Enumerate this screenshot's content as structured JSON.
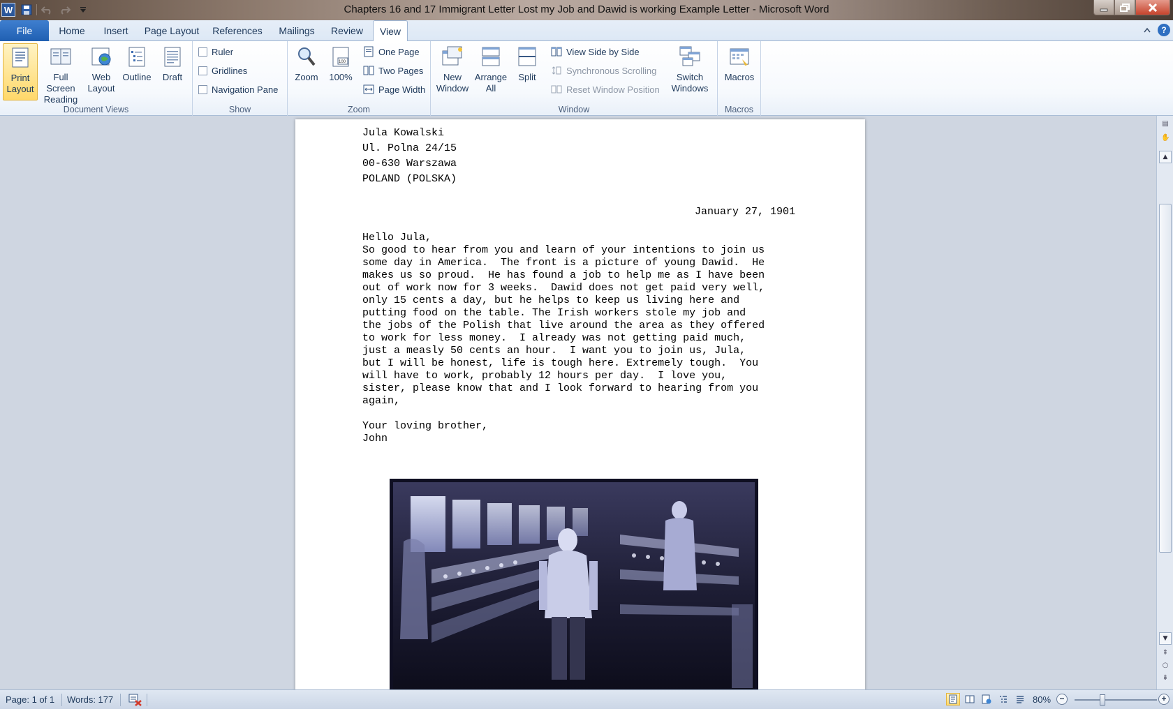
{
  "window": {
    "title": "Chapters 16 and 17 Immigrant Letter  Lost my Job and Dawid is working  Example Letter  -  Microsoft Word",
    "app_logo": "W"
  },
  "tabs": {
    "file": "File",
    "items": [
      "Home",
      "Insert",
      "Page Layout",
      "References",
      "Mailings",
      "Review",
      "View"
    ],
    "active": "View"
  },
  "ribbon": {
    "document_views": {
      "label": "Document Views",
      "print_layout": [
        "Print",
        "Layout"
      ],
      "full_screen": [
        "Full Screen",
        "Reading"
      ],
      "web_layout": [
        "Web",
        "Layout"
      ],
      "outline": "Outline",
      "draft": "Draft"
    },
    "show": {
      "label": "Show",
      "ruler": "Ruler",
      "gridlines": "Gridlines",
      "navigation_pane": "Navigation Pane"
    },
    "zoom": {
      "label": "Zoom",
      "zoom": "Zoom",
      "hundred": "100%",
      "one_page": "One Page",
      "two_pages": "Two Pages",
      "page_width": "Page Width"
    },
    "window": {
      "label": "Window",
      "new_window": [
        "New",
        "Window"
      ],
      "arrange_all": [
        "Arrange",
        "All"
      ],
      "split": "Split",
      "side_by_side": "View Side by Side",
      "sync_scrolling": "Synchronous Scrolling",
      "reset_position": "Reset Window Position",
      "switch_windows": [
        "Switch",
        "Windows"
      ]
    },
    "macros": {
      "label": "Macros",
      "macros": "Macros"
    }
  },
  "document": {
    "address": [
      "Jula Kowalski",
      "Ul. Polna 24/15",
      "00-630 Warszawa",
      "POLAND (POLSKA)"
    ],
    "date": "January 27, 1901",
    "salutation": "Hello Jula,",
    "body": "So good to hear from you and learn of your intentions to join us\nsome day in America.  The front is a picture of young Dawid.  He\nmakes us so proud.  He has found a job to help me as I have been\nout of work now for 3 weeks.  Dawid does not get paid very well,\nonly 15 cents a day, but he helps to keep us living here and\nputting food on the table. The Irish workers stole my job and\nthe jobs of the Polish that live around the area as they offered\nto work for less money.  I already was not getting paid much,\njust a measly 50 cents an hour.  I want you to join us, Jula,\nbut I will be honest, life is tough here. Extremely tough.  You\nwill have to work, probably 12 hours per day.  I love you,\nsister, please know that and I look forward to hearing from you\nagain,",
    "closing": [
      "Your loving brother,",
      "John"
    ]
  },
  "status": {
    "page": "Page: 1 of 1",
    "words": "Words: 177",
    "zoom": "80%",
    "zoom_level_percent": 80
  }
}
